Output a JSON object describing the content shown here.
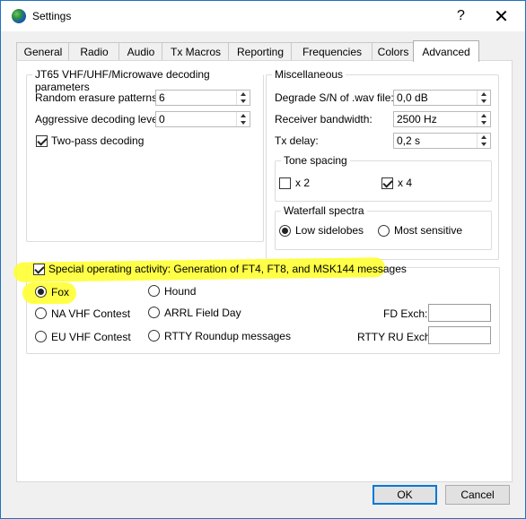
{
  "window": {
    "title": "Settings",
    "help_glyph": "?",
    "close_glyph": "✕"
  },
  "tabs": [
    {
      "label": "General"
    },
    {
      "label": "Radio"
    },
    {
      "label": "Audio"
    },
    {
      "label": "Tx Macros"
    },
    {
      "label": "Reporting"
    },
    {
      "label": "Frequencies"
    },
    {
      "label": "Colors"
    },
    {
      "label": "Advanced",
      "active": true
    }
  ],
  "jt65": {
    "title": "JT65 VHF/UHF/Microwave decoding parameters",
    "random_erasure_label": "Random erasure patterns:",
    "random_erasure_value": "6",
    "aggressive_label": "Aggressive decoding level:",
    "aggressive_value": "0",
    "two_pass_label": "Two-pass decoding",
    "two_pass_checked": true
  },
  "misc": {
    "title": "Miscellaneous",
    "degrade_label": "Degrade S/N of .wav file:",
    "degrade_value": "0,0 dB",
    "bandwidth_label": "Receiver bandwidth:",
    "bandwidth_value": "2500  Hz",
    "txdelay_label": "Tx delay:",
    "txdelay_value": "0,2  s",
    "tone_spacing": {
      "title": "Tone spacing",
      "x2_label": "x 2",
      "x2_checked": false,
      "x4_label": "x 4",
      "x4_checked": true
    },
    "waterfall": {
      "title": "Waterfall spectra",
      "low_label": "Low sidelobes",
      "low_selected": true,
      "most_label": "Most sensitive",
      "most_selected": false
    }
  },
  "special": {
    "label": "Special operating activity:  Generation of FT4, FT8, and MSK144 messages",
    "checked": true,
    "options": {
      "fox": "Fox",
      "hound": "Hound",
      "na_vhf": "NA VHF Contest",
      "arrl_fd": "ARRL Field Day",
      "eu_vhf": "EU VHF Contest",
      "rtty": "RTTY Roundup messages"
    },
    "selected": "fox",
    "fd_exch_label": "FD Exch:",
    "fd_exch_value": "",
    "rtty_exch_label": "RTTY RU Exch:",
    "rtty_exch_value": ""
  },
  "buttons": {
    "ok": "OK",
    "cancel": "Cancel"
  },
  "colors": {
    "highlight": "#ffff33",
    "accent": "#0078d7"
  }
}
